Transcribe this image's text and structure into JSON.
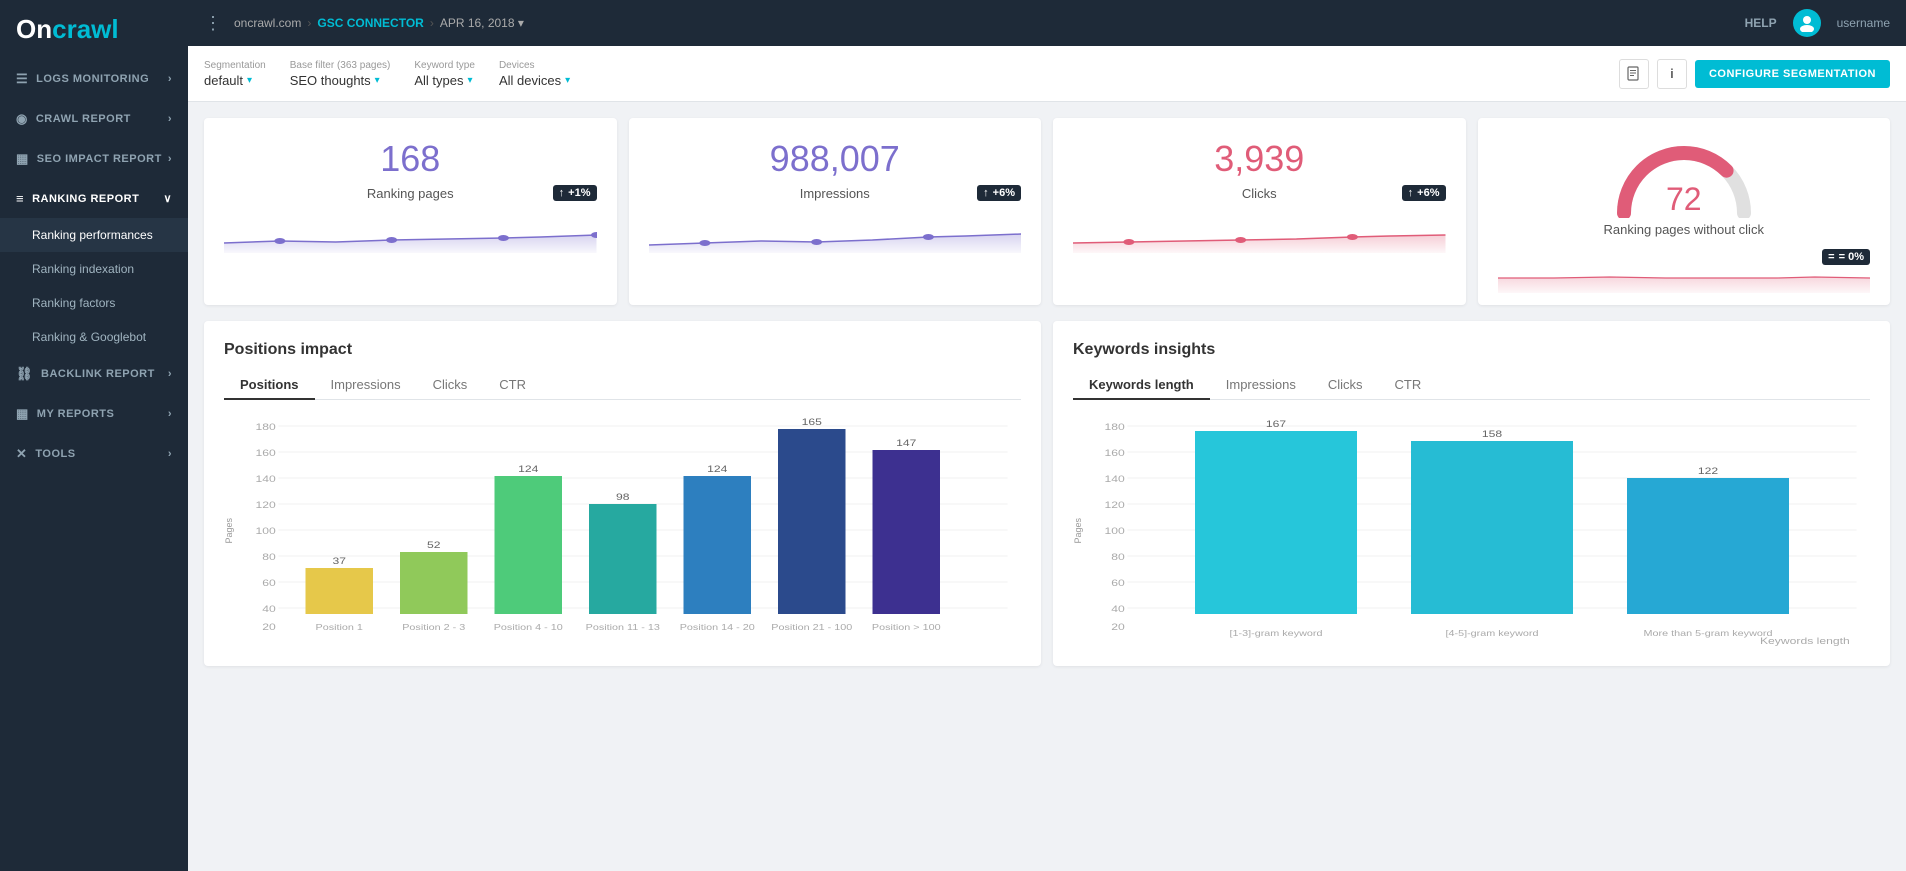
{
  "app": {
    "logo_on": "On",
    "logo_crawl": "crawl"
  },
  "topbar": {
    "site_name": "oncrawl.com",
    "separator1": ">",
    "connector": "GSC CONNECTOR",
    "separator2": ">",
    "date": "APR 16, 2018",
    "date_icon": "▾",
    "help": "HELP",
    "username": "username"
  },
  "filterbar": {
    "segmentation_label": "Segmentation",
    "segmentation_value": "default",
    "base_filter_label": "Base filter (363 pages)",
    "base_filter_value": "SEO thoughts",
    "keyword_type_label": "Keyword type",
    "keyword_type_value": "All types",
    "devices_label": "Devices",
    "devices_value": "All devices",
    "configure_btn": "CONFIGURE SEGMENTATION"
  },
  "kpis": [
    {
      "id": "ranking-pages",
      "value": "168",
      "label": "Ranking pages",
      "trend": "+1%",
      "trend_type": "positive",
      "color": "#7c6fcd"
    },
    {
      "id": "impressions",
      "value": "988,007",
      "label": "Impressions",
      "trend": "+6%",
      "trend_type": "positive",
      "color": "#7c6fcd"
    },
    {
      "id": "clicks",
      "value": "3,939",
      "label": "Clicks",
      "trend": "+6%",
      "trend_type": "positive",
      "color": "#e05c78"
    },
    {
      "id": "ranking-no-click",
      "value": "72",
      "label": "Ranking pages without click",
      "trend": "= 0%",
      "trend_type": "neutral",
      "color": "#e05c78"
    }
  ],
  "positions_impact": {
    "title": "Positions impact",
    "tabs": [
      "Positions",
      "Impressions",
      "Clicks",
      "CTR"
    ],
    "active_tab": "Positions",
    "y_label": "Pages",
    "bars": [
      {
        "label": "Position 1",
        "value": 37,
        "color": "#e6c84a"
      },
      {
        "label": "Position 2 - 3",
        "value": 52,
        "color": "#90c95a"
      },
      {
        "label": "Position 4 - 10",
        "value": 124,
        "color": "#4ecb7a"
      },
      {
        "label": "Position 11 - 13",
        "value": 98,
        "color": "#26a9a0"
      },
      {
        "label": "Position 14 - 20",
        "value": 124,
        "color": "#2d7fbf"
      },
      {
        "label": "Position 21 - 100",
        "value": 165,
        "color": "#2b4a8c"
      },
      {
        "label": "Position > 100",
        "value": 147,
        "color": "#3d3090"
      }
    ],
    "max_value": 180
  },
  "keywords_insights": {
    "title": "Keywords insights",
    "tabs": [
      "Keywords length",
      "Impressions",
      "Clicks",
      "CTR"
    ],
    "active_tab": "Keywords length",
    "y_label": "Pages",
    "x_label": "Keywords length",
    "bars": [
      {
        "label": "[1-3]-gram keyword",
        "value": 167,
        "color": "#26c6da"
      },
      {
        "label": "[4-5]-gram keyword",
        "value": 158,
        "color": "#26bcd4"
      },
      {
        "label": "More than 5-gram keyword",
        "value": 122,
        "color": "#26a8d4"
      }
    ],
    "max_value": 180
  },
  "sidebar": {
    "nav_items": [
      {
        "id": "logs-monitoring",
        "label": "LOGS MONITORING",
        "icon": "☰",
        "expanded": false
      },
      {
        "id": "crawl-report",
        "label": "CRAWL REPORT",
        "icon": "◉",
        "expanded": false
      },
      {
        "id": "seo-impact-report",
        "label": "SEO IMPACT REPORT",
        "icon": "▦",
        "expanded": false
      },
      {
        "id": "ranking-report",
        "label": "RANKING REPORT",
        "icon": "≡",
        "expanded": true
      },
      {
        "id": "backlink-report",
        "label": "BACKLINK REPORT",
        "icon": "🔗",
        "expanded": false
      },
      {
        "id": "my-reports",
        "label": "MY REPORTS",
        "icon": "▦",
        "expanded": false
      },
      {
        "id": "tools",
        "label": "TOOLS",
        "icon": "✕",
        "expanded": false
      }
    ],
    "sub_items": [
      {
        "id": "ranking-performances",
        "label": "Ranking performances",
        "active": true
      },
      {
        "id": "ranking-indexation",
        "label": "Ranking indexation",
        "active": false
      },
      {
        "id": "ranking-factors",
        "label": "Ranking factors",
        "active": false
      },
      {
        "id": "ranking-googlebot",
        "label": "Ranking & Googlebot",
        "active": false
      }
    ]
  }
}
